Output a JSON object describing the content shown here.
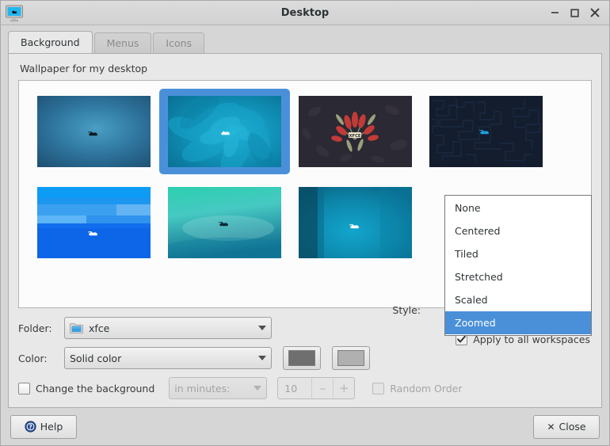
{
  "window": {
    "title": "Desktop",
    "icon": "desktop-monitor-icon",
    "controls": {
      "minimize": "_",
      "maximize": "□",
      "close": "✕"
    }
  },
  "tabs": [
    {
      "label": "Background",
      "active": true
    },
    {
      "label": "Menus",
      "active": false
    },
    {
      "label": "Icons",
      "active": false
    }
  ],
  "background_tab": {
    "section_label": "Wallpaper for my desktop",
    "wallpapers": [
      {
        "name": "xfce-blue-glow",
        "selected": false
      },
      {
        "name": "xfce-teal-spiral",
        "selected": true
      },
      {
        "name": "xfce-red-flower",
        "selected": false
      },
      {
        "name": "xfce-dark-maze",
        "selected": false
      },
      {
        "name": "xfce-blue-stripes",
        "selected": false
      },
      {
        "name": "xfce-teal-gradient",
        "selected": false
      },
      {
        "name": "xfce-cyan-bands",
        "selected": false
      }
    ],
    "folder": {
      "label": "Folder:",
      "value": "xfce",
      "icon": "folder-icon"
    },
    "color": {
      "label": "Color:",
      "value": "Solid color"
    },
    "color_swatch_1": "#6f6f6f",
    "color_swatch_2": "#b0b0b0",
    "style": {
      "label": "Style:",
      "selected": "Zoomed",
      "options": [
        "None",
        "Centered",
        "Tiled",
        "Stretched",
        "Scaled",
        "Zoomed"
      ]
    },
    "apply_all_workspaces": {
      "label": "Apply to all workspaces",
      "checked": true
    },
    "change_background": {
      "label": "Change the background",
      "checked": false,
      "enabled": false
    },
    "interval_unit": {
      "value": "in minutes:",
      "enabled": false
    },
    "interval_value": {
      "value": "10",
      "minus": "–",
      "plus": "+",
      "enabled": false
    },
    "random_order": {
      "label": "Random Order",
      "checked": false,
      "enabled": false
    }
  },
  "actions": {
    "help": "Help",
    "close": "Close",
    "close_glyph": "✕"
  },
  "colors": {
    "accent": "#4a90d9",
    "window_bg": "#d6d6d6",
    "panel_bg": "#e8e8e8",
    "view_bg": "#fcfcfc"
  }
}
